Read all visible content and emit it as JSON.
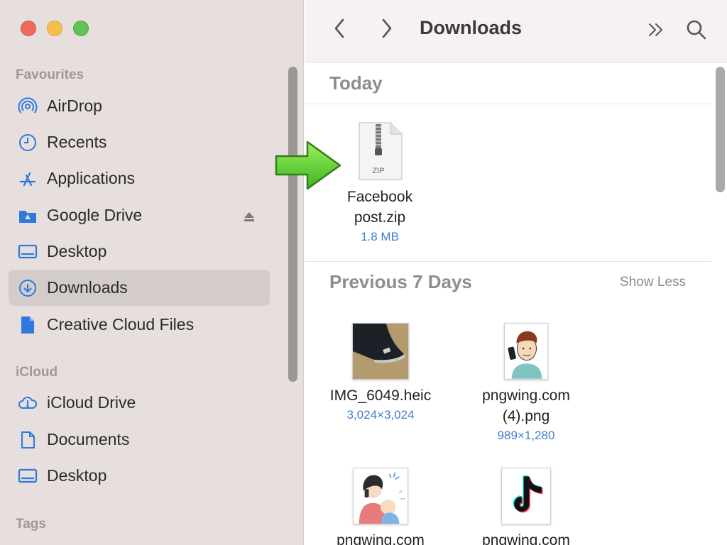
{
  "window": {
    "title": "Downloads",
    "traffic_lights": {
      "close": "#ed6a5e",
      "minimize": "#f5bf4f",
      "zoom": "#61c454"
    }
  },
  "toolbar": {
    "back_icon": "chevron-left-icon",
    "forward_icon": "chevron-right-icon",
    "more_icon": "double-chevron-right-icon",
    "search_icon": "search-icon"
  },
  "sidebar": {
    "favourites_label": "Favourites",
    "favourites": [
      {
        "label": "AirDrop",
        "icon": "airdrop-icon"
      },
      {
        "label": "Recents",
        "icon": "clock-icon"
      },
      {
        "label": "Applications",
        "icon": "applications-icon"
      },
      {
        "label": "Google Drive",
        "icon": "google-drive-folder-icon"
      },
      {
        "label": "Desktop",
        "icon": "desktop-icon"
      },
      {
        "label": "Downloads",
        "icon": "downloads-icon",
        "selected": true
      },
      {
        "label": "Creative Cloud Files",
        "icon": "document-icon"
      }
    ],
    "icloud_label": "iCloud",
    "icloud": [
      {
        "label": "iCloud Drive",
        "icon": "icloud-warning-icon"
      },
      {
        "label": "Documents",
        "icon": "document-outline-icon"
      },
      {
        "label": "Desktop",
        "icon": "desktop-icon"
      }
    ],
    "tags_label": "Tags"
  },
  "content": {
    "today": {
      "title": "Today",
      "files": [
        {
          "name_line1": "Facebook",
          "name_line2": "post.zip",
          "meta": "1.8 MB",
          "icon": "zip-file-icon",
          "zip_label": "ZIP"
        }
      ]
    },
    "previous": {
      "title": "Previous 7 Days",
      "show_less": "Show Less",
      "files": [
        {
          "name_line1": "IMG_6049.heic",
          "name_line2": "",
          "meta": "3,024×3,024"
        },
        {
          "name_line1": "pngwing.com",
          "name_line2": "(4).png",
          "meta": "989×1,280"
        },
        {
          "name_line1": "pngwing.com",
          "name_line2": "",
          "meta": ""
        },
        {
          "name_line1": "pngwing.com",
          "name_line2": "",
          "meta": ""
        }
      ]
    }
  },
  "accent_color": "#2d79e0"
}
